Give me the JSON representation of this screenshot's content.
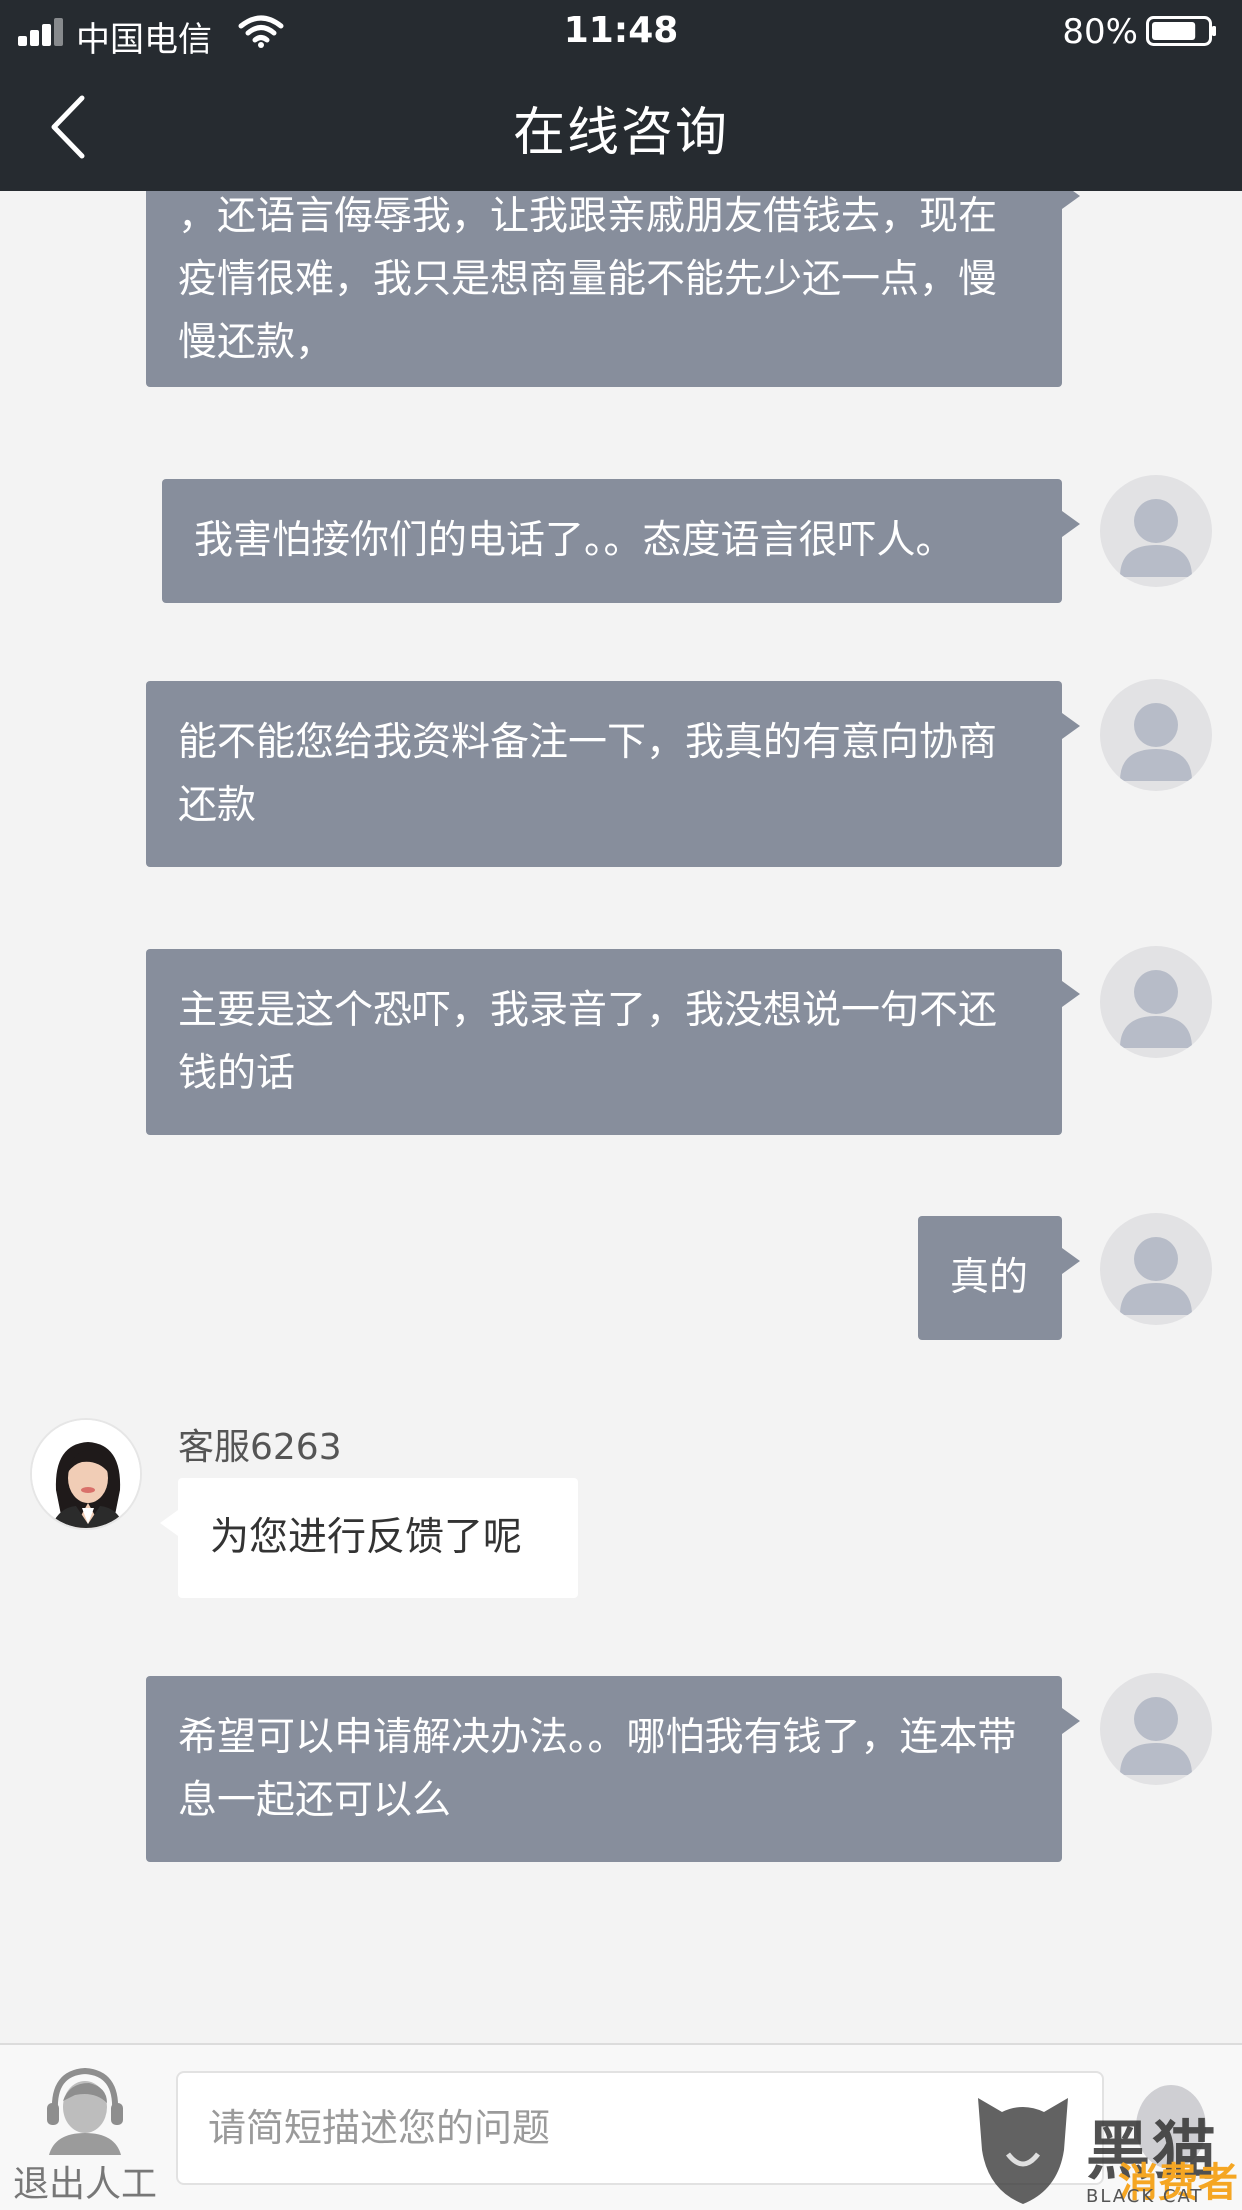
{
  "status_bar": {
    "carrier": "中国电信",
    "time": "11:48",
    "battery_percent": "80%",
    "battery_level": 0.8
  },
  "nav": {
    "title": "在线咨询"
  },
  "messages": [
    {
      "role": "user",
      "text": "，还语言侮辱我，让我跟亲戚朋友借钱去，现在疫情很难，我只是想商量能不能先少还一点，慢慢还款，"
    },
    {
      "role": "user",
      "text": "我害怕接你们的电话了。。态度语言很吓人。"
    },
    {
      "role": "user",
      "text": "能不能您给我资料备注一下，我真的有意向协商还款"
    },
    {
      "role": "user",
      "text": "主要是这个恐吓，我录音了，我没想说一句不还钱的话"
    },
    {
      "role": "user",
      "text": "真的"
    },
    {
      "role": "agent",
      "name": "客服6263",
      "text": "为您进行反馈了呢"
    },
    {
      "role": "user",
      "text": "希望可以申请解决办法。。哪怕我有钱了，连本带息一起还可以么"
    }
  ],
  "bottom_bar": {
    "exit_label": "退出人工",
    "input_placeholder": "请简短描述您的问题"
  },
  "watermark": {
    "brand": "黑猫",
    "brand_en": "BLACK CAT",
    "brand_sub": "消费者"
  }
}
